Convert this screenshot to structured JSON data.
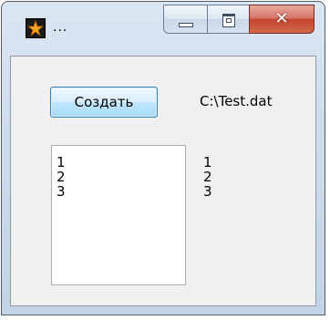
{
  "window": {
    "title": "..."
  },
  "form": {
    "create_button_label": "Создать",
    "path_label": "C:\\Test.dat",
    "listbox_items": [
      "1",
      "2",
      "3"
    ],
    "label_lines": [
      "1",
      "2",
      "3"
    ]
  }
}
